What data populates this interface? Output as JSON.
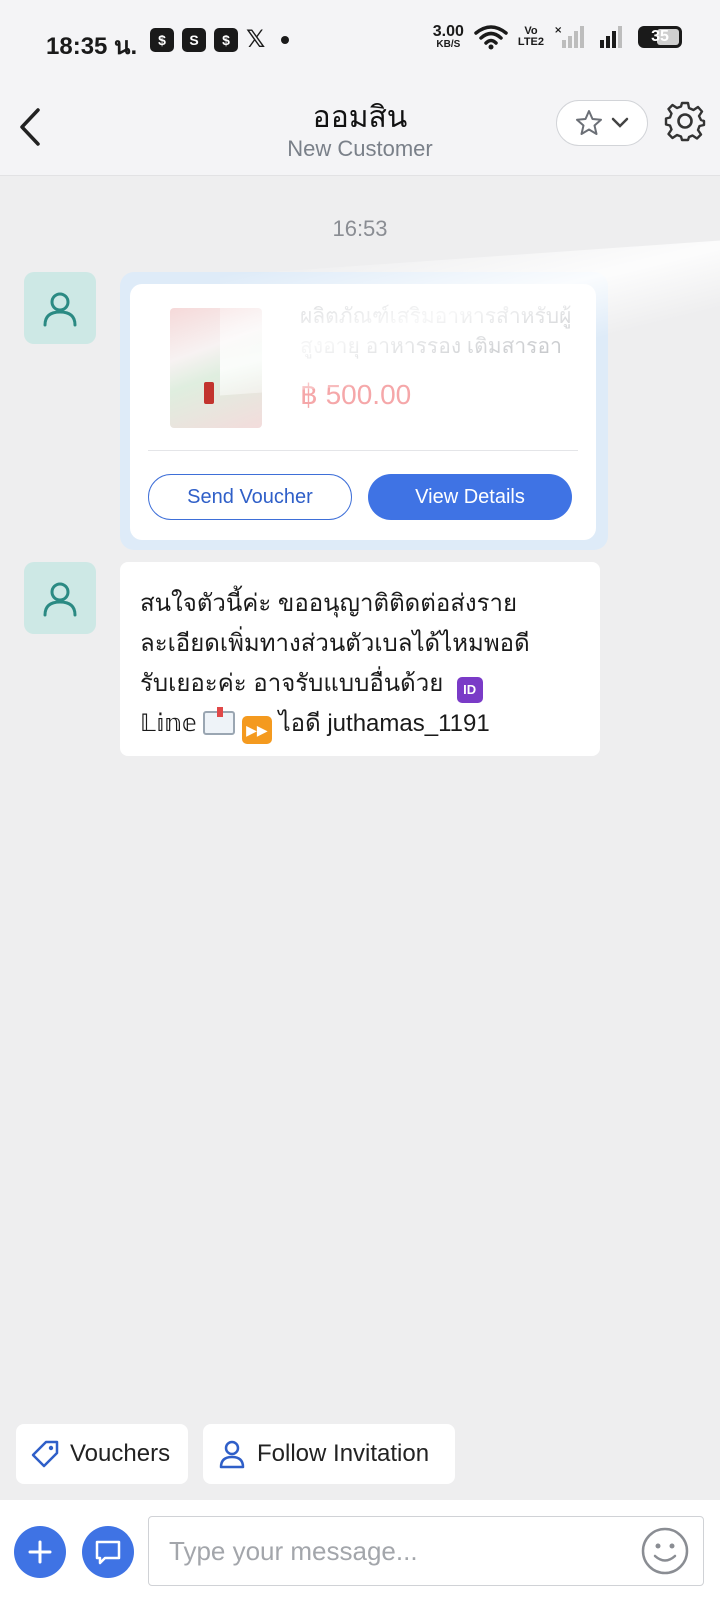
{
  "status_bar": {
    "time": "18:35 น.",
    "net_speed_value": "3.00",
    "net_speed_unit": "KB/S",
    "volte_top": "Vo",
    "volte_bottom": "LTE2",
    "battery": "35"
  },
  "header": {
    "title": "ออมสิน",
    "subtitle": "New Customer"
  },
  "chat": {
    "timestamp": "16:53",
    "product": {
      "name": "ผลิตภัณฑ์เสริมอาหารสำหรับผู้สูงอายุ อาหารรอง เติมสารอาหารแ...",
      "price": "฿ 500.00",
      "send_voucher_label": "Send Voucher",
      "view_details_label": "View Details"
    },
    "message": {
      "line1": "สนใจตัวนี้ค่ะ ขออนุญาติติดต่อส่งราย",
      "line2": "ละเอียดเพิ่มทางส่วนตัวเบลได้ไหมพอดี",
      "line3": "รับเยอะค่ะ อาจรับแบบอื่นด้วย",
      "id_emoji": "ID",
      "line4_prefix": "𝕃𝕚𝕟𝕖",
      "line4_suffix": "ไอดี  juthamas_1191"
    }
  },
  "quick_actions": {
    "vouchers_label": "Vouchers",
    "follow_label": "Follow Invitation"
  },
  "composer": {
    "placeholder": "Type your message..."
  },
  "colors": {
    "accent": "#3f73e4",
    "avatar_bg": "#cde8e5",
    "avatar_icon": "#2b8a83",
    "price": "#f5a7a9"
  }
}
